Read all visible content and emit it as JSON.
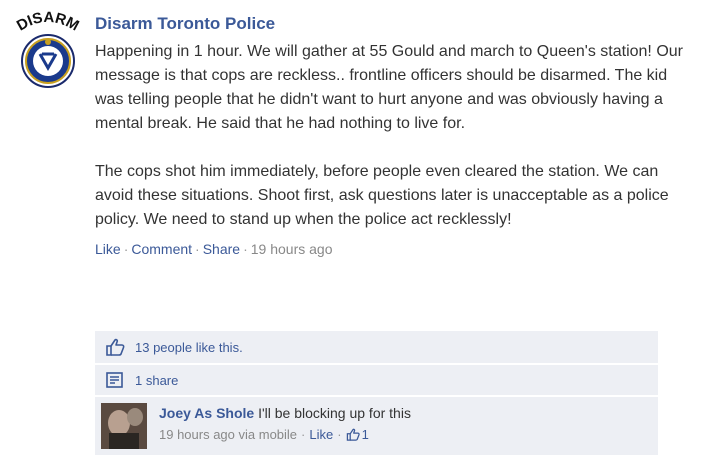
{
  "post": {
    "avatar_text": "DISARM",
    "author": "Disarm Toronto Police",
    "message_paragraphs": [
      "Happening in 1 hour. We will gather at 55 Gould and march to Queen's station! Our message is that cops are reckless.. frontline officers should be disarmed. The kid was telling people that he didn't want to hurt anyone and was obviously having a mental break. He said that he had nothing to live for.",
      "The cops shot him immediately, before people even cleared the station. We can avoid these situations. Shoot first, ask questions later is unacceptable as a police policy. We need to stand up when the police act recklessly!"
    ],
    "actions": {
      "like": "Like",
      "comment": "Comment",
      "share": "Share",
      "separator": "·",
      "timestamp": "19 hours ago"
    }
  },
  "ufi": {
    "likes_text": "13 people like this.",
    "shares_text": "1 share"
  },
  "comment": {
    "author": "Joey As Shole",
    "text": "I'll be blocking up for this",
    "timestamp": "19 hours ago via mobile",
    "like_label": "Like",
    "like_count": "1",
    "separator": "·"
  },
  "colors": {
    "link": "#3b5998",
    "ufi_background": "#edeff4"
  }
}
